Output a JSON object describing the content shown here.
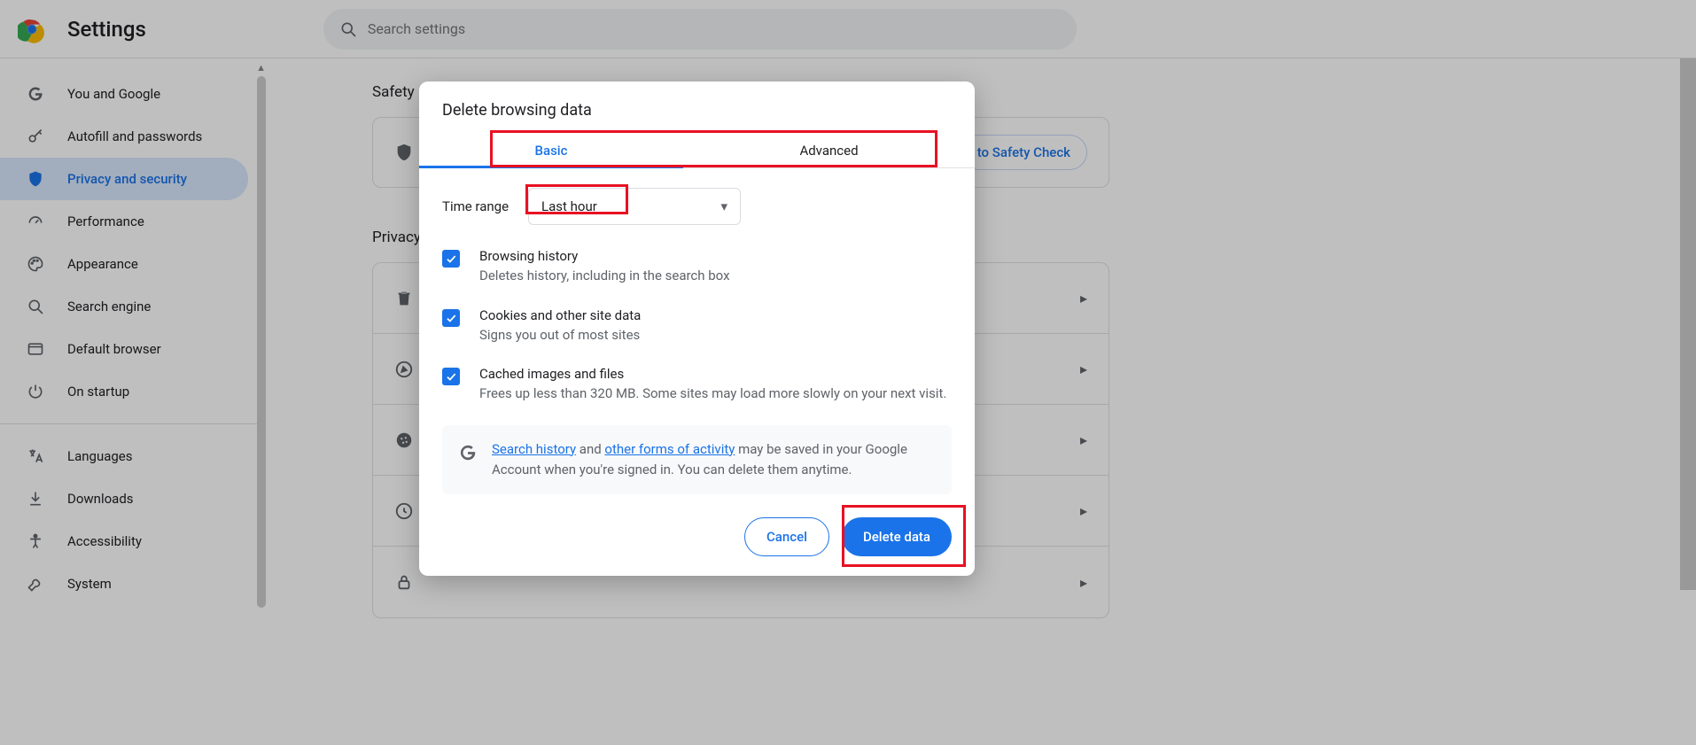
{
  "header": {
    "title": "Settings",
    "search_placeholder": "Search settings"
  },
  "sidebar": {
    "items": [
      {
        "label": "You and Google",
        "icon": "google"
      },
      {
        "label": "Autofill and passwords",
        "icon": "key"
      },
      {
        "label": "Privacy and security",
        "icon": "shield",
        "active": true
      },
      {
        "label": "Performance",
        "icon": "gauge"
      },
      {
        "label": "Appearance",
        "icon": "palette"
      },
      {
        "label": "Search engine",
        "icon": "search"
      },
      {
        "label": "Default browser",
        "icon": "browser"
      },
      {
        "label": "On startup",
        "icon": "power"
      }
    ],
    "items2": [
      {
        "label": "Languages",
        "icon": "lang"
      },
      {
        "label": "Downloads",
        "icon": "download"
      },
      {
        "label": "Accessibility",
        "icon": "a11y"
      },
      {
        "label": "System",
        "icon": "wrench"
      }
    ]
  },
  "content": {
    "safety_title": "Safety",
    "safety_btn": "to Safety Check",
    "privacy_title": "Privacy"
  },
  "dialog": {
    "title": "Delete browsing data",
    "tabs": {
      "basic": "Basic",
      "advanced": "Advanced"
    },
    "time_label": "Time range",
    "time_value": "Last hour",
    "opts": [
      {
        "title": "Browsing history",
        "sub": "Deletes history, including in the search box"
      },
      {
        "title": "Cookies and other site data",
        "sub": "Signs you out of most sites"
      },
      {
        "title": "Cached images and files",
        "sub": "Frees up less than 320 MB. Some sites may load more slowly on your next visit."
      }
    ],
    "info": {
      "link1": "Search history",
      "mid1": " and ",
      "link2": "other forms of activity",
      "rest": " may be saved in your Google Account when you're signed in. You can delete them anytime."
    },
    "cancel": "Cancel",
    "delete": "Delete data"
  },
  "highlights": [
    "tabs",
    "time-range-select",
    "delete-button"
  ]
}
